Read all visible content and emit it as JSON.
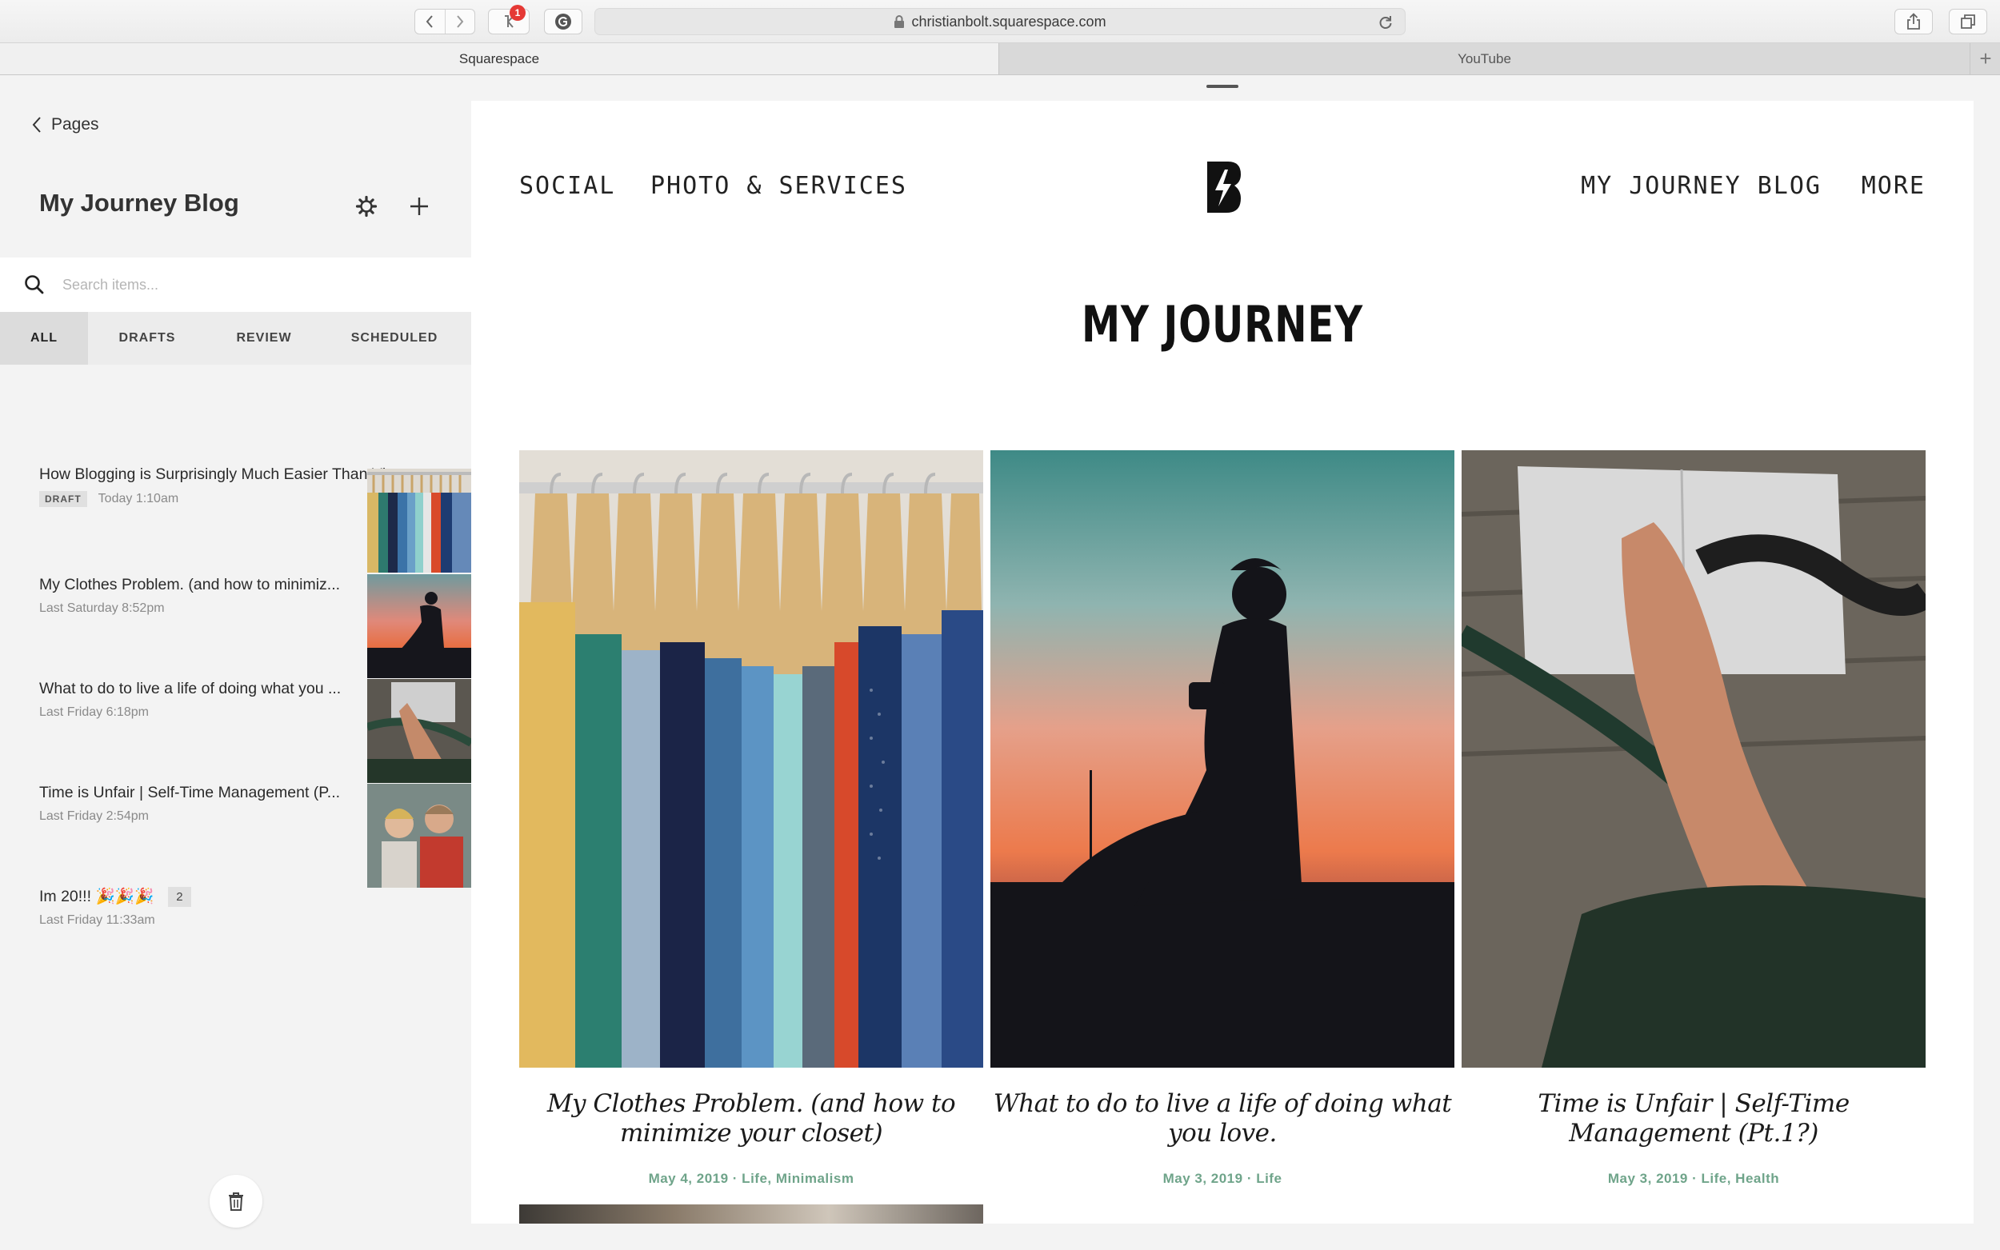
{
  "browser": {
    "url": "christianbolt.squarespace.com",
    "extension_badge": "1",
    "tabs": [
      {
        "label": "Squarespace"
      },
      {
        "label": "YouTube"
      }
    ],
    "new_tab_glyph": "+"
  },
  "sidebar": {
    "back_label": "Pages",
    "title": "My Journey Blog",
    "search_placeholder": "Search items...",
    "filters": [
      "ALL",
      "DRAFTS",
      "REVIEW",
      "SCHEDULED"
    ],
    "active_filter": "ALL",
    "posts": [
      {
        "title": "How Blogging is Surprisingly Much Easier Than Vlog...",
        "badge": "DRAFT",
        "time": "Today 1:10am"
      },
      {
        "title": "My Clothes Problem. (and how to minimiz...",
        "time": "Last Saturday 8:52pm",
        "thumb": "clothes"
      },
      {
        "title": "What to do to live a life of doing what you ...",
        "time": "Last Friday 6:18pm",
        "thumb": "sunset"
      },
      {
        "title": "Time is Unfair | Self-Time Management (P...",
        "time": "Last Friday 2:54pm",
        "thumb": "notebook"
      },
      {
        "title": "Im 20!!! 🎉🎉🎉",
        "count": "2",
        "time": "Last Friday 11:33am",
        "thumb": "friends"
      }
    ]
  },
  "site": {
    "nav_left": [
      "SOCIAL",
      "PHOTO & SERVICES"
    ],
    "nav_right": [
      "MY JOURNEY BLOG",
      "MORE"
    ],
    "heading": "MY JOURNEY",
    "cards": [
      {
        "title": "My Clothes Problem. (and how to minimize your closet)",
        "meta": "May 4, 2019 · Life, Minimalism"
      },
      {
        "title": "What to do to live a life of doing what you love.",
        "meta": "May 3, 2019 · Life"
      },
      {
        "title": "Time is Unfair | Self-Time Management (Pt.1?)",
        "meta": "May 3, 2019 · Life, Health"
      }
    ]
  },
  "colors": {
    "accent_green": "#6fa48a",
    "sidebar_bg": "#f3f3f3",
    "badge_red": "#e53935"
  }
}
